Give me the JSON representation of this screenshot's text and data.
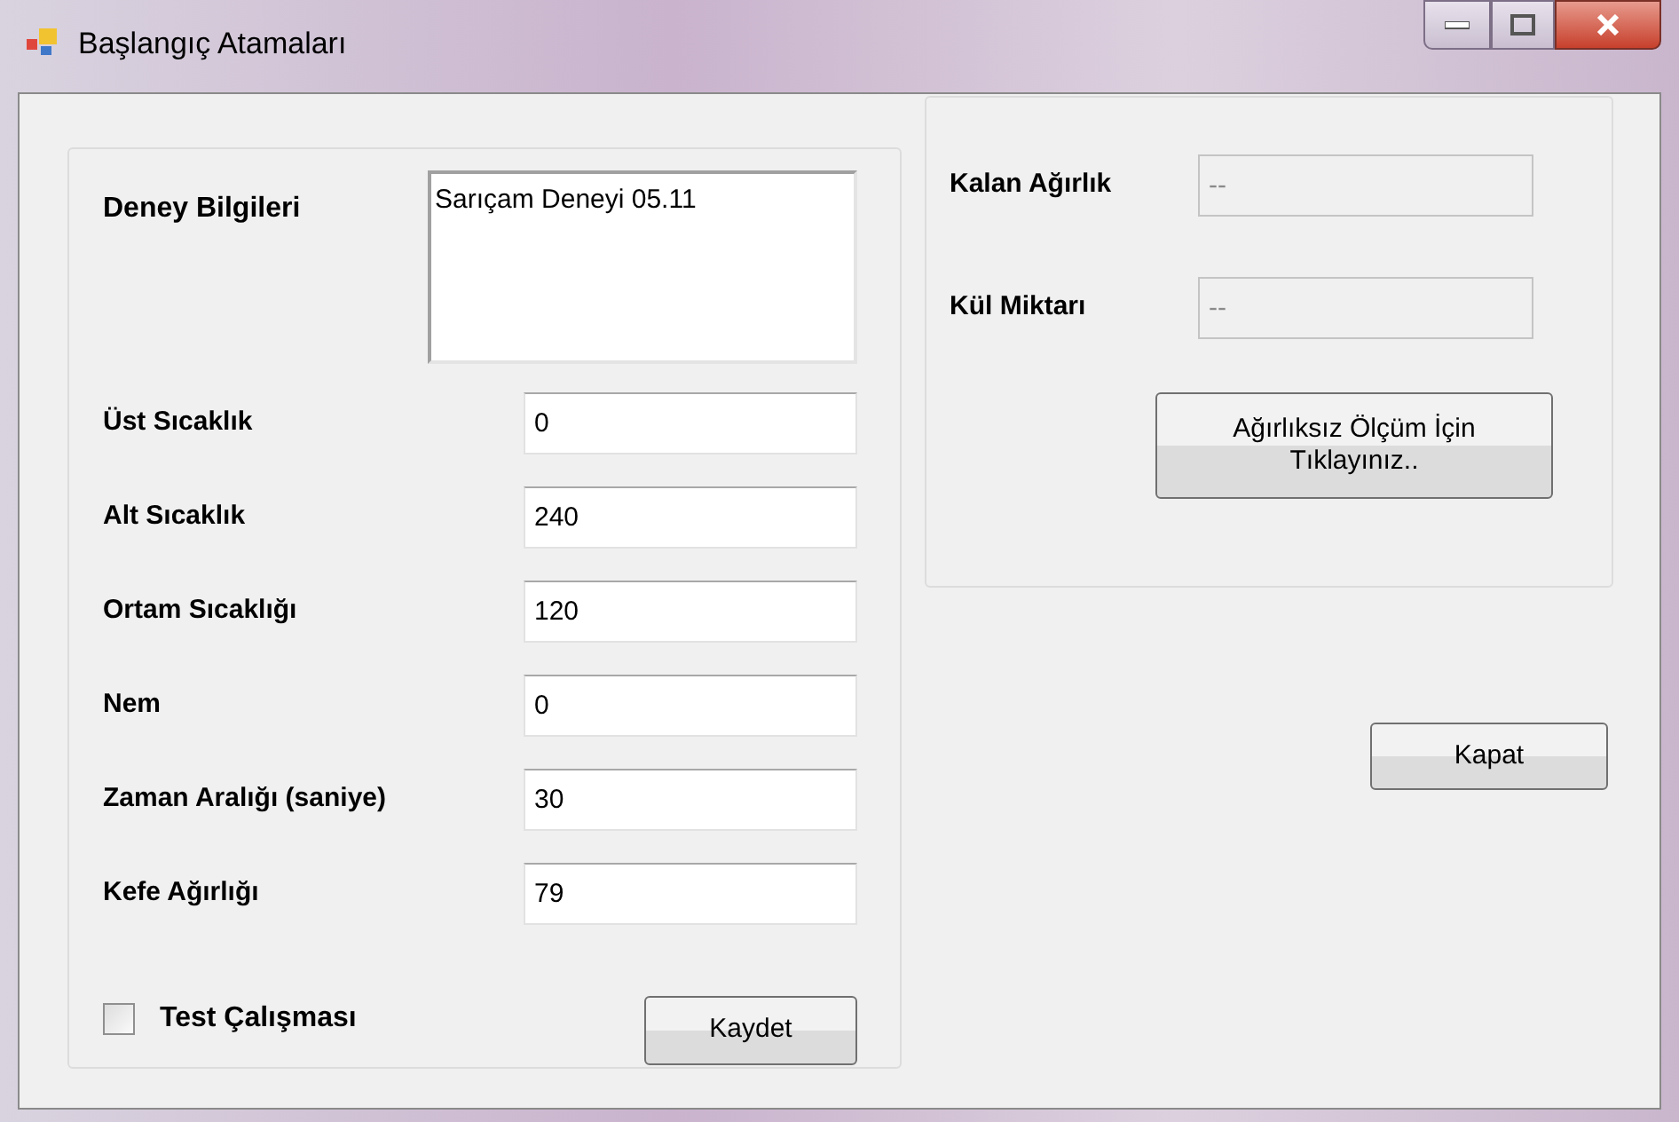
{
  "window": {
    "title": "Başlangıç Atamaları"
  },
  "experiment": {
    "label": "Deney Bilgileri",
    "value": "Sarıçam Deneyi 05.11"
  },
  "fields": [
    {
      "label": "Üst Sıcaklık",
      "value": "0",
      "disabled": false
    },
    {
      "label": "Alt Sıcaklık",
      "value": "240",
      "disabled": false
    },
    {
      "label": "Ortam Sıcaklığı",
      "value": "120",
      "disabled": false
    },
    {
      "label": "Nem",
      "value": "0",
      "disabled": false
    },
    {
      "label": "Zaman Aralığı (saniye)",
      "value": "30",
      "disabled": false
    },
    {
      "label": "Kefe Ağırlığı",
      "value": "79",
      "disabled": false
    }
  ],
  "test_run": {
    "label": "Test Çalışması",
    "checked": false
  },
  "save_button": "Kaydet",
  "results": [
    {
      "label": "Kalan Ağırlık",
      "value": "--",
      "disabled": true
    },
    {
      "label": "Kül Miktarı",
      "value": "--",
      "disabled": true
    }
  ],
  "weightless_button": "Ağırlıksız Ölçüm İçin Tıklayınız..",
  "close_button": "Kapat"
}
